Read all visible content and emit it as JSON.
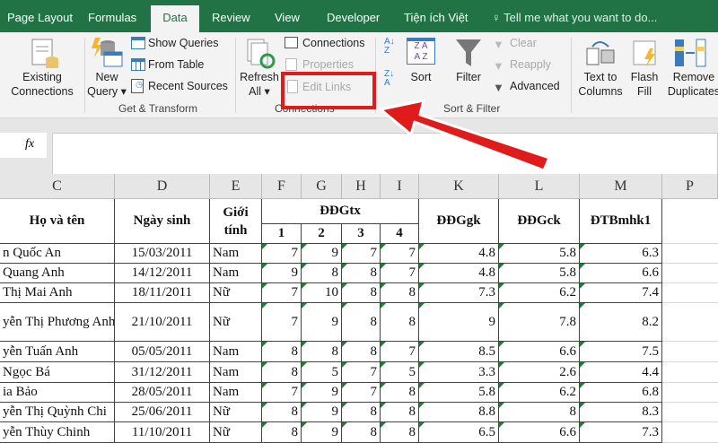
{
  "tabs": [
    "Page Layout",
    "Formulas",
    "Data",
    "Review",
    "View",
    "Developer",
    "Tiện ích Việt"
  ],
  "active_tab": "Data",
  "tell_me": "Tell me what you want to do...",
  "ribbon": {
    "existing_connections": "Existing Connections",
    "new_query": "New Query ▾",
    "show_queries": "Show Queries",
    "from_table": "From Table",
    "recent_sources": "Recent Sources",
    "get_transform": "Get & Transform",
    "refresh_all": "Refresh All ▾",
    "connections": "Connections",
    "properties": "Properties",
    "edit_links": "Edit Links",
    "connections_group": "Connections",
    "sort": "Sort",
    "filter": "Filter",
    "clear": "Clear",
    "reapply": "Reapply",
    "advanced": "Advanced",
    "sort_filter": "Sort & Filter",
    "text_to_columns": "Text to Columns",
    "flash_fill": "Flash Fill",
    "remove_duplicates": "Remove Duplicates"
  },
  "formula_bar": {
    "fx": "fx",
    "value": ""
  },
  "columns": [
    "C",
    "D",
    "E",
    "F",
    "G",
    "H",
    "I",
    "K",
    "L",
    "M",
    "P"
  ],
  "headers": {
    "name": "Họ và tên",
    "dob": "Ngày sinh",
    "gender": "Giới tính",
    "ddgtx": "ĐĐGtx",
    "sub": [
      "1",
      "2",
      "3",
      "4"
    ],
    "gk": "ĐĐGgk",
    "ck": "ĐĐGck",
    "tb": "ĐTBmhk1"
  },
  "rows": [
    [
      "n Quốc An",
      "15/03/2011",
      "Nam",
      "7",
      "9",
      "7",
      "7",
      "4.8",
      "5.8",
      "6.3"
    ],
    [
      " Quang Anh",
      "14/12/2011",
      "Nam",
      "9",
      "8",
      "8",
      "7",
      "4.8",
      "5.8",
      "6.6"
    ],
    [
      "Thị Mai Anh",
      "18/11/2011",
      "Nữ",
      "7",
      "10",
      "8",
      "8",
      "7.3",
      "6.2",
      "7.4"
    ],
    [
      "yễn Thị Phương Anh",
      "21/10/2011",
      "Nữ",
      "7",
      "9",
      "8",
      "8",
      "9",
      "7.8",
      "8.2"
    ],
    [
      "yễn Tuấn Anh",
      "05/05/2011",
      "Nam",
      "8",
      "8",
      "8",
      "7",
      "8.5",
      "6.6",
      "7.5"
    ],
    [
      "Ngọc Bá",
      "31/12/2011",
      "Nam",
      "8",
      "5",
      "7",
      "5",
      "3.3",
      "2.6",
      "4.4"
    ],
    [
      "ia Bảo",
      "28/05/2011",
      "Nam",
      "7",
      "9",
      "7",
      "8",
      "5.8",
      "6.2",
      "6.8"
    ],
    [
      "yễn Thị Quỳnh Chi",
      "25/06/2011",
      "Nữ",
      "8",
      "9",
      "8",
      "8",
      "8.8",
      "8",
      "8.3"
    ],
    [
      "yễn Thùy Chinh",
      "11/10/2011",
      "Nữ",
      "8",
      "9",
      "8",
      "8",
      "6.5",
      "6.6",
      "7.3"
    ]
  ],
  "colors": {
    "excel_green": "#217346",
    "highlight_red": "#e01b1b"
  }
}
